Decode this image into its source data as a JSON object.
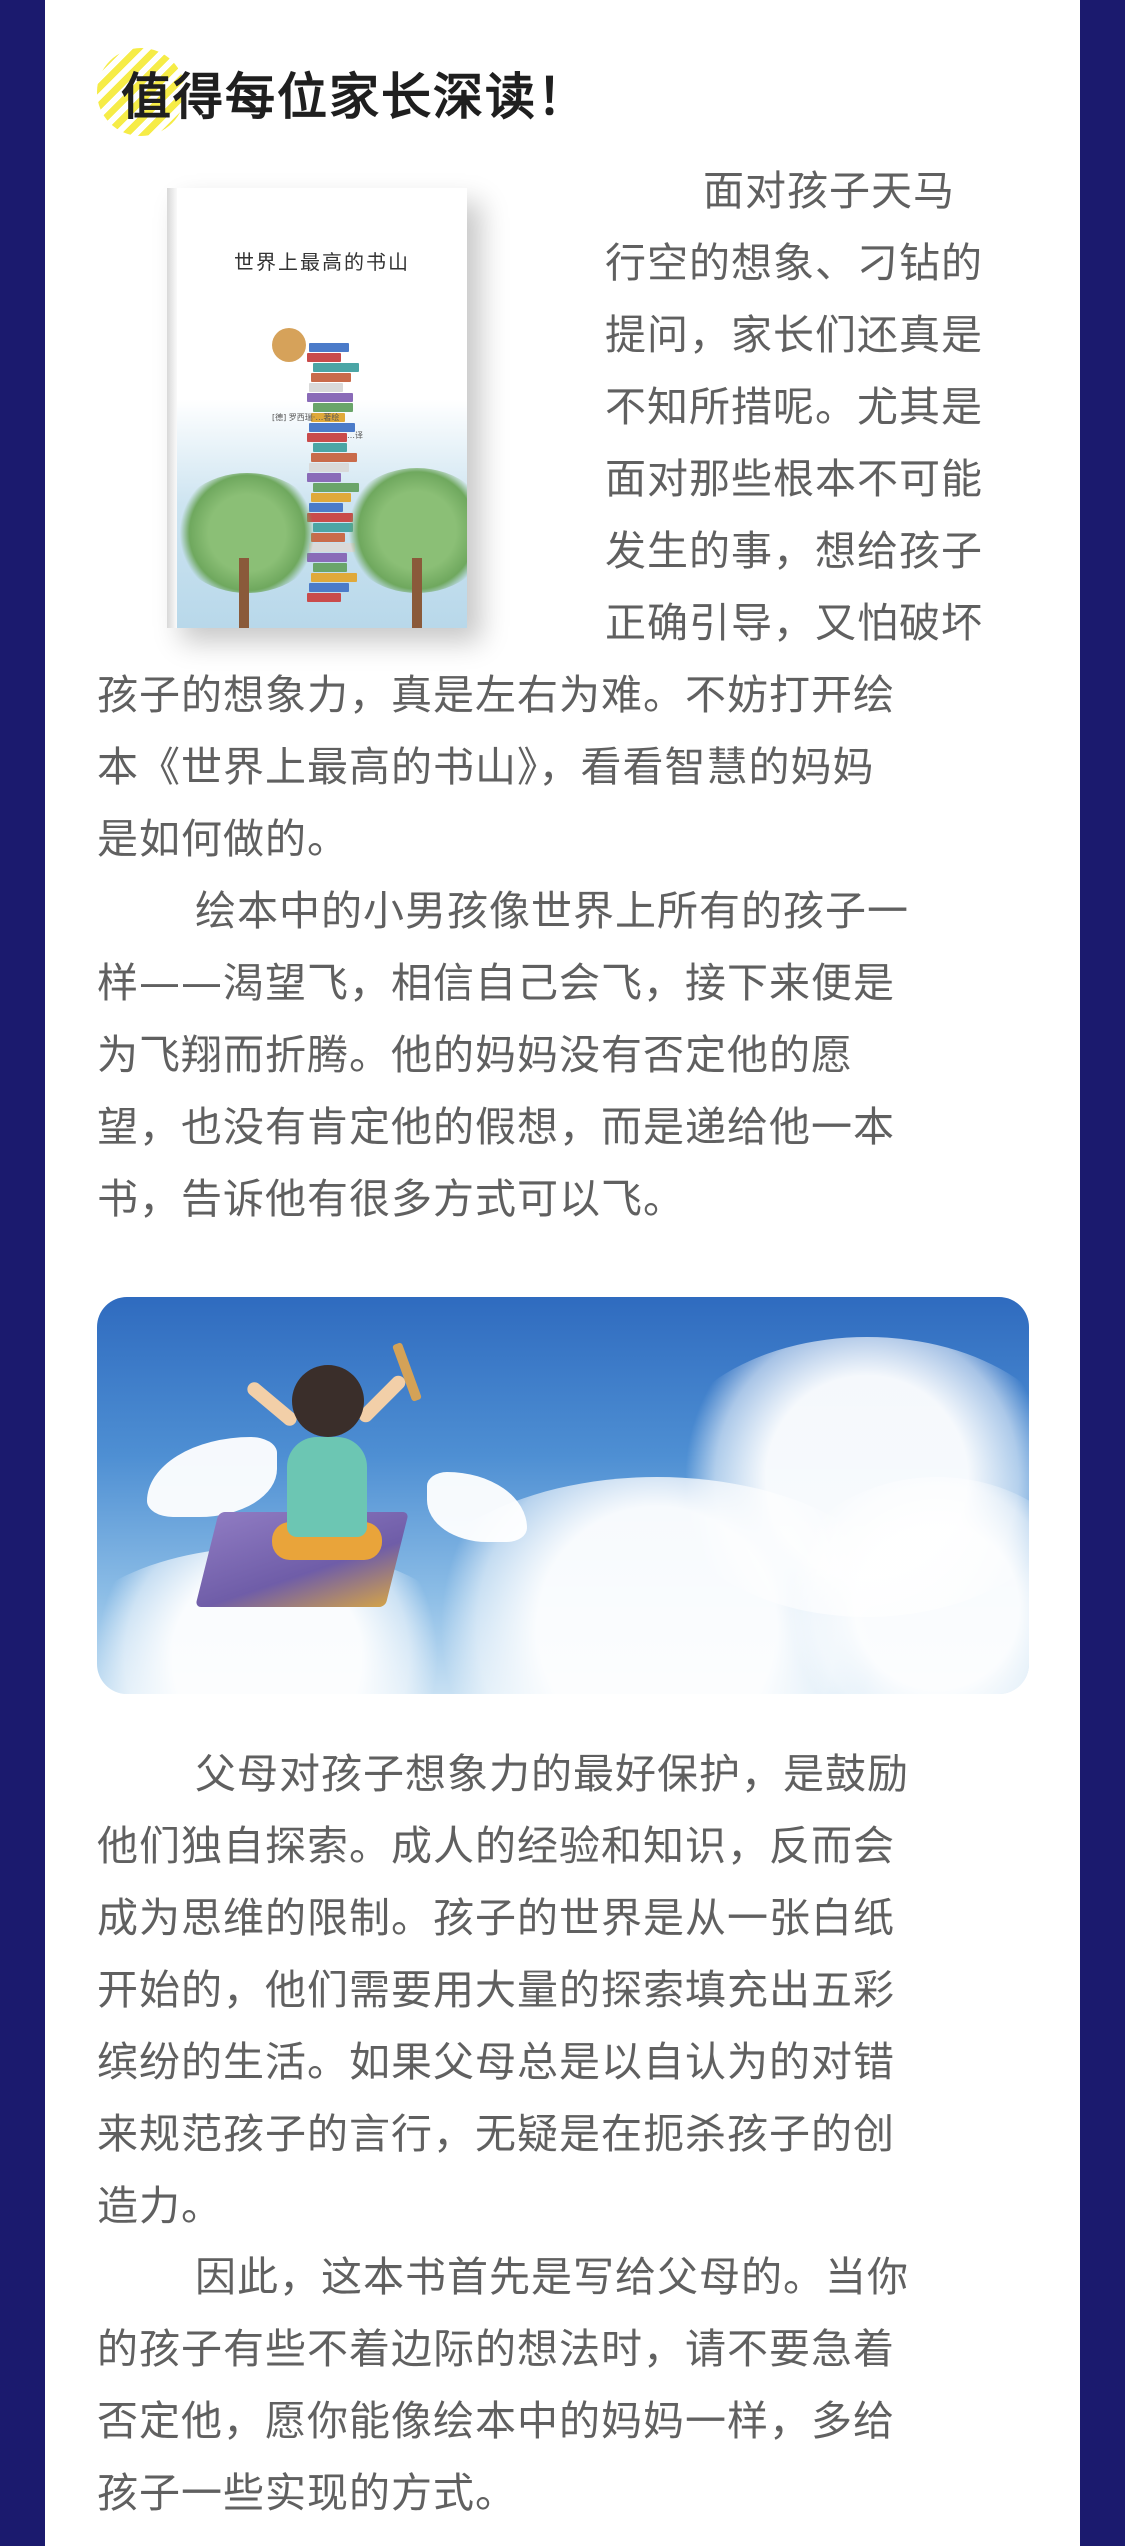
{
  "section_title": "值得每位家长深读！",
  "book": {
    "title": "世界上最高的书山",
    "author_line": "[德] 罗西瑞·…著绘",
    "translator_line": "…译"
  },
  "paragraph1": {
    "wrapped_lines": [
      "面对孩子天马",
      "行空的想象、刁钻的",
      "提问，家长们还真是",
      "不知所措呢。尤其是",
      "面对那些根本不可能",
      "发生的事，想给孩子",
      "正确引导，又怕破坏"
    ],
    "full_lines": [
      "孩子的想象力，真是左右为难。不妨打开绘",
      "本《世界上最高的书山》，看看智慧的妈妈",
      "是如何做的。"
    ]
  },
  "paragraph2": {
    "lines": [
      "绘本中的小男孩像世界上所有的孩子一",
      "样——渴望飞，相信自己会飞，接下来便是",
      "为飞翔而折腾。他的妈妈没有否定他的愿",
      "望，也没有肯定他的假想，而是递给他一本",
      "书，告诉他有很多方式可以飞。"
    ]
  },
  "paragraph3": {
    "lines": [
      "父母对孩子想象力的最好保护，是鼓励",
      "他们独自探索。成人的经验和知识，反而会",
      "成为思维的限制。孩子的世界是从一张白纸",
      "开始的，他们需要用大量的探索填充出五彩",
      "缤纷的生活。如果父母总是以自认为的对错",
      "来规范孩子的言行，无疑是在扼杀孩子的创",
      "造力。"
    ]
  },
  "paragraph4": {
    "lines": [
      "因此，这本书首先是写给父母的。当你",
      "的孩子有些不着边际的想法时，请不要急着",
      "否定他，愿你能像绘本中的妈妈一样，多给",
      "孩子一些实现的方式。"
    ]
  },
  "colors": {
    "frame": "#1b1a6e",
    "body_text": "#606060",
    "heading_text": "#1f1f1f",
    "heading_accent": "#f6ec47"
  }
}
